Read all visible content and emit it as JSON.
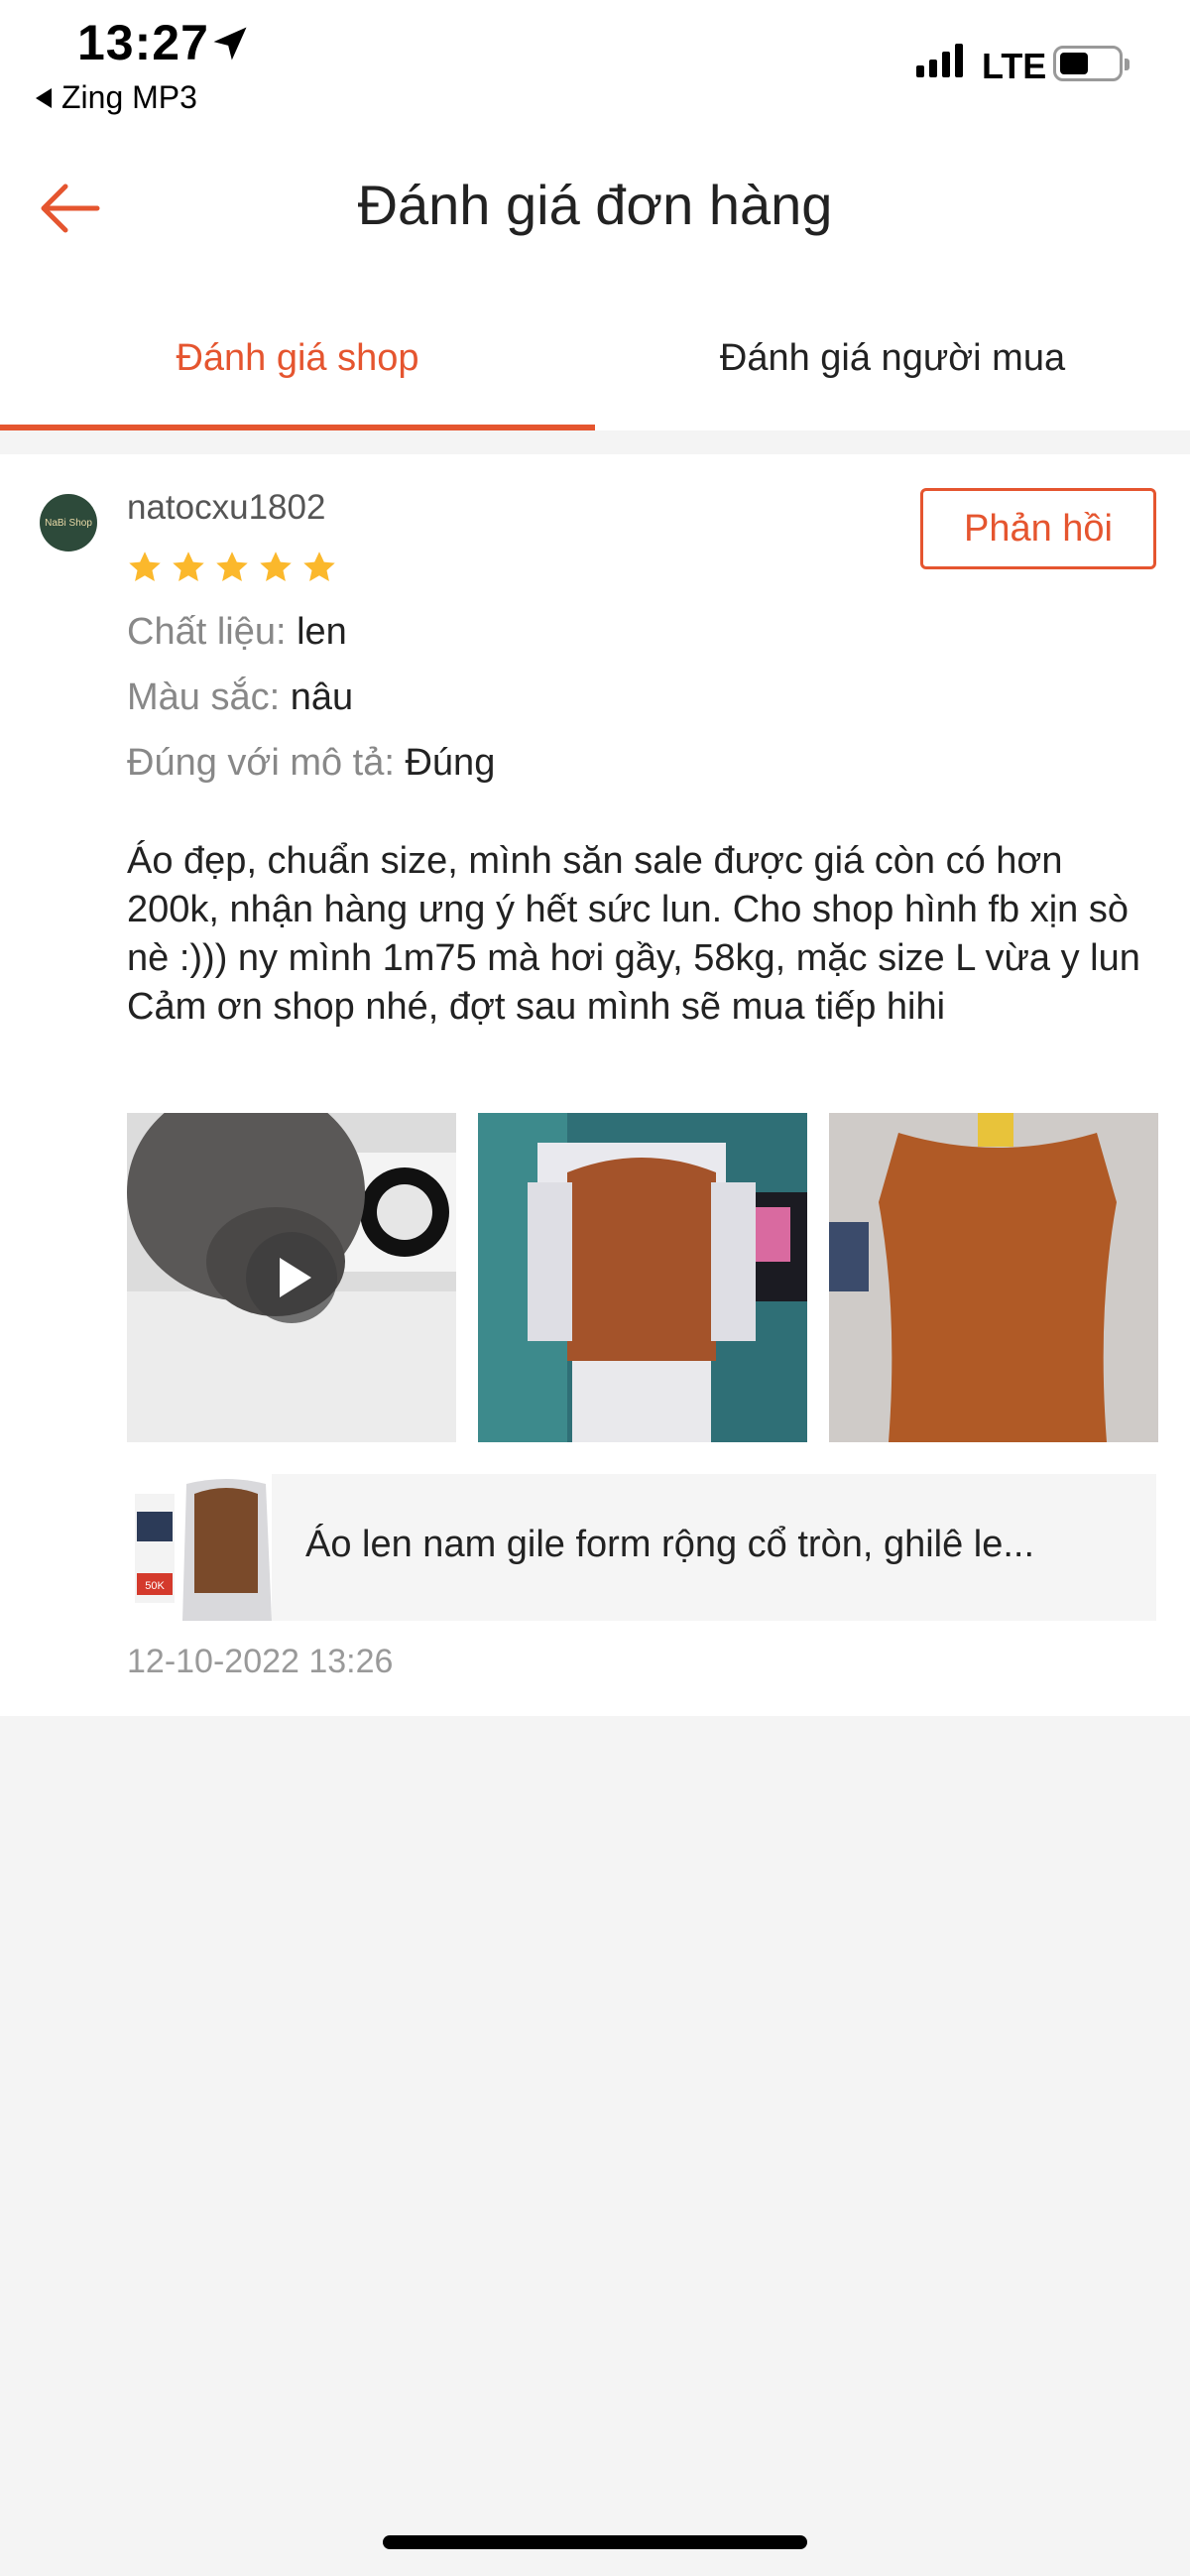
{
  "status_bar": {
    "time": "13:27",
    "back_app": "Zing MP3",
    "network": "LTE"
  },
  "header": {
    "title": "Đánh giá đơn hàng",
    "back_icon": "arrow-left-icon"
  },
  "tabs": [
    {
      "label": "Đánh giá shop",
      "active": true
    },
    {
      "label": "Đánh giá người mua",
      "active": false
    }
  ],
  "review": {
    "avatar_text": "NaBi Shop",
    "username": "natocxu1802",
    "rating": 5,
    "reply_label": "Phản hồi",
    "attributes": [
      {
        "key": "Chất liệu:",
        "value": "len"
      },
      {
        "key": "Màu sắc:",
        "value": "nâu"
      },
      {
        "key": "Đúng với mô tả:",
        "value": "Đúng"
      }
    ],
    "text": "Áo đẹp, chuẩn size, mình săn sale được giá còn có hơn 200k, nhận hàng ưng ý hết sức lun. Cho shop hình fb xịn sò nè :))) ny mình 1m75 mà hơi gầy, 58kg, mặc size L vừa y lun\nCảm ơn shop nhé, đợt sau mình sẽ mua tiếp hihi",
    "media": [
      {
        "type": "video",
        "name": "review-video-cat"
      },
      {
        "type": "image",
        "name": "review-photo-wearing-vest"
      },
      {
        "type": "image",
        "name": "review-photo-vest-flat"
      }
    ],
    "product": {
      "name": "Áo len nam gile form rộng  cổ tròn, ghilê le...",
      "thumb_price": "50K"
    },
    "date": "12-10-2022 13:26"
  },
  "colors": {
    "accent": "#e5552f",
    "star": "#fbb82c"
  }
}
